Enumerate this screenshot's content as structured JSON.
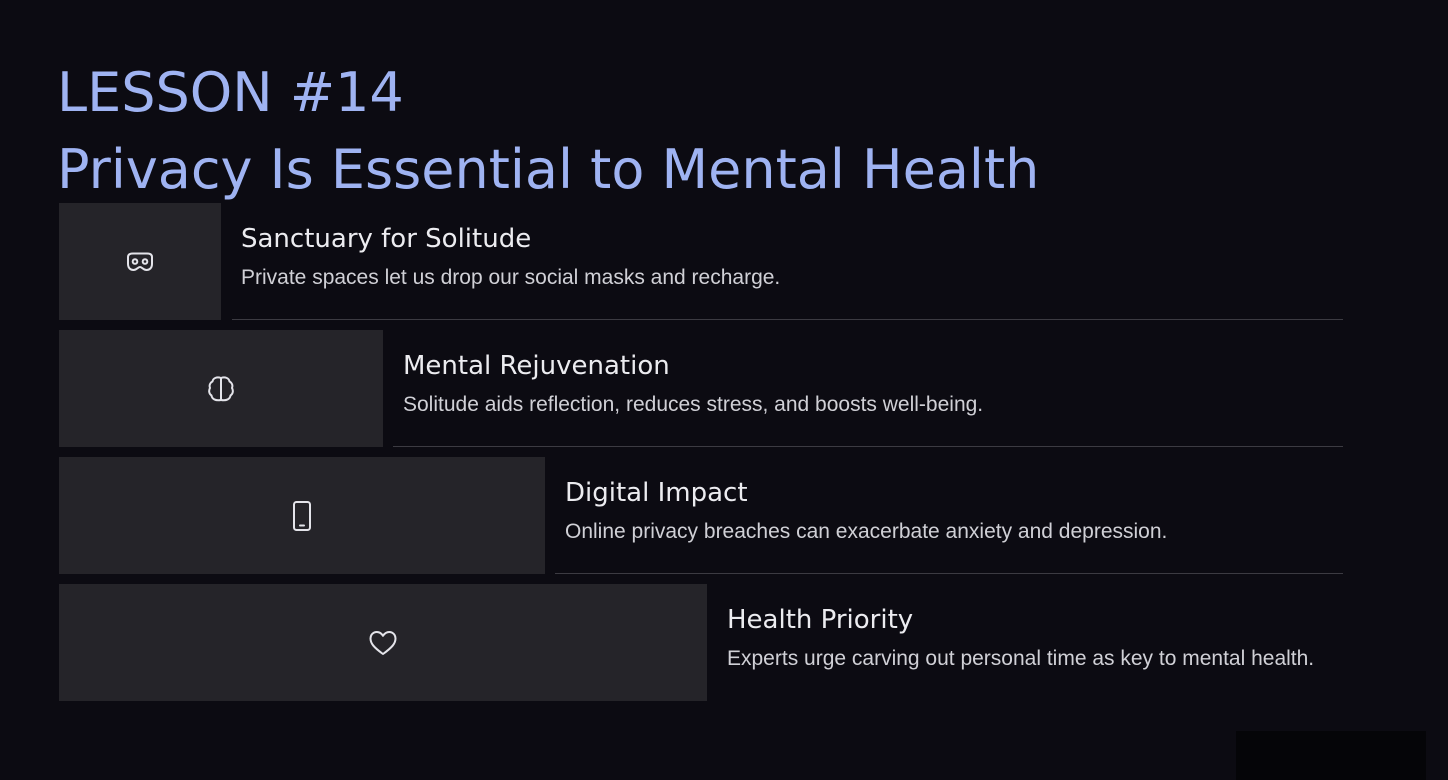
{
  "header": {
    "lesson": "LESSON #14",
    "title": "Privacy Is Essential to Mental Health"
  },
  "items": [
    {
      "icon": "mask-icon",
      "title": "Sanctuary for Solitude",
      "description": "Private spaces let us drop our social masks and recharge."
    },
    {
      "icon": "brain-icon",
      "title": "Mental Rejuvenation",
      "description": "Solitude aids reflection, reduces stress, and boosts well-being."
    },
    {
      "icon": "smartphone-icon",
      "title": "Digital Impact",
      "description": "Online privacy breaches can exacerbate anxiety and depression."
    },
    {
      "icon": "heart-icon",
      "title": "Health Priority",
      "description": "Experts urge carving out personal time as key to mental health."
    }
  ],
  "colors": {
    "background": "#0c0b12",
    "title": "#9fb3f2",
    "card": "#252429",
    "divider": "#3c3b42"
  }
}
